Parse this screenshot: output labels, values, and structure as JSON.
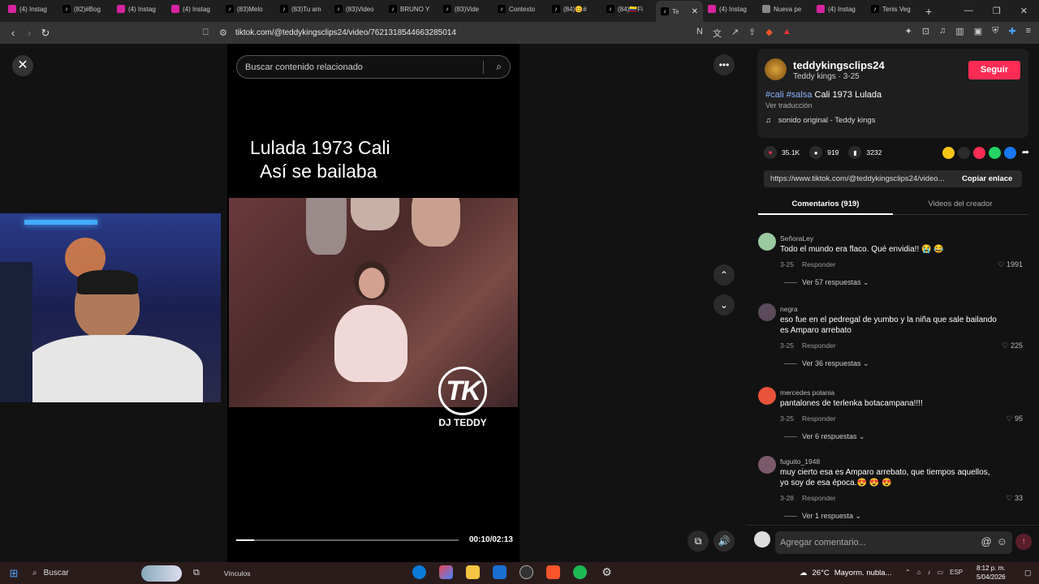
{
  "browser": {
    "tabs": [
      {
        "label": "(4) Instag",
        "icon": "instagram-icon",
        "color": "#d6249f"
      },
      {
        "label": "(82)#Bog",
        "icon": "tiktok-icon",
        "color": "#000000"
      },
      {
        "label": "(4) Instag",
        "icon": "instagram-icon",
        "color": "#d6249f"
      },
      {
        "label": "(4) Instag",
        "icon": "instagram-icon",
        "color": "#d6249f"
      },
      {
        "label": "(83)Melo",
        "icon": "tiktok-icon",
        "color": "#000000"
      },
      {
        "label": "(83)Tu am",
        "icon": "tiktok-icon",
        "color": "#000000"
      },
      {
        "label": "(83)Video",
        "icon": "tiktok-icon",
        "color": "#000000"
      },
      {
        "label": "BRUNO Y",
        "icon": "tiktok-icon",
        "color": "#000000"
      },
      {
        "label": "(83)Vide",
        "icon": "tiktok-icon",
        "color": "#000000"
      },
      {
        "label": "Contexto",
        "icon": "tiktok-icon",
        "color": "#000000"
      },
      {
        "label": "(84)😊#",
        "icon": "tiktok-icon",
        "color": "#000000"
      },
      {
        "label": "(84)🇨🇴Fi",
        "icon": "tiktok-icon",
        "color": "#000000"
      },
      {
        "label": "Te",
        "icon": "tiktok-icon",
        "color": "#000000",
        "active": true
      },
      {
        "label": "(4) Instag",
        "icon": "instagram-icon",
        "color": "#d6249f"
      },
      {
        "label": "Nueva pe",
        "icon": "brave-shield-icon",
        "color": "#888888"
      },
      {
        "label": "(4) Instag",
        "icon": "instagram-icon",
        "color": "#d6249f"
      },
      {
        "label": "Tenis Veg",
        "icon": "tiktok-icon",
        "color": "#000000"
      }
    ],
    "url": "tiktok.com/@teddykingsclips24/video/7621318544663285014"
  },
  "video": {
    "search_placeholder": "Buscar contenido relacionado",
    "caption_line1": "Lulada 1973 Cali",
    "caption_line2": "Así se bailaba",
    "watermark_logo": "TK",
    "watermark_name": "DJ TEDDY",
    "time": "00:10/02:13",
    "progress_fraction": 0.08
  },
  "creator": {
    "username": "teddykingsclips24",
    "subtitle": "Teddy kings · 3-25",
    "follow_label": "Seguir",
    "tag1": "#cali",
    "tag2": "#salsa",
    "title": "Cali 1973 Lulada",
    "translate_label": "Ver traducción",
    "sound": "sonido original - Teddy kings"
  },
  "stats": {
    "likes": "35.1K",
    "comments": "919",
    "saves": "3232"
  },
  "share": {
    "link": "https://www.tiktok.com/@teddykingsclips24/video...",
    "copy_label": "Copiar enlace"
  },
  "panel_tabs": {
    "comments": "Comentarios (919)",
    "videos": "Videos del creador"
  },
  "comments": [
    {
      "user": "SeñoraLey",
      "text": "Todo el mundo era flaco. Qué envidia!! 😭 😂",
      "date": "3-25",
      "reply_label": "Responder",
      "likes": "1991",
      "replies": "Ver 57 respuestas"
    },
    {
      "user": "negra",
      "text": "eso fue en el pedregal de yumbo y la niña que sale bailando es Amparo arrebato",
      "date": "3-25",
      "reply_label": "Responder",
      "likes": "225",
      "replies": "Ver 36 respuestas"
    },
    {
      "user": "mercedes polania",
      "text": "pantalones de terlenka botacampana!!!!",
      "date": "3-25",
      "reply_label": "Responder",
      "likes": "95",
      "replies": "Ver 6 respuestas"
    },
    {
      "user": "fuguito_1948",
      "text": "muy cierto esa es Amparo arrebato, que tiempos aquellos, yo soy de esa época.😍 😍 😍",
      "date": "3-28",
      "reply_label": "Responder",
      "likes": "33",
      "replies": "Ver 1 respuesta"
    }
  ],
  "add_comment_placeholder": "Agregar comentario...",
  "taskbar": {
    "search_label": "Buscar",
    "links_label": "Vínculos",
    "weather": "26°C",
    "weather_desc": "Mayorm. nubla...",
    "lang": "ESP",
    "time": "8:12 p. m.",
    "date": "5/04/2026"
  },
  "colors": {
    "accent": "#fe2c55",
    "hashtag": "#8ab4ff"
  }
}
